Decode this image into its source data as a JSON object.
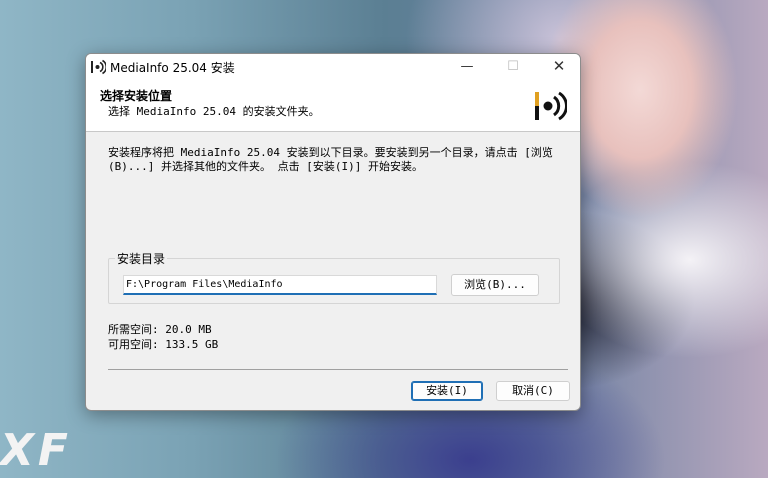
{
  "wallpaper": {
    "watermark": "XF"
  },
  "window": {
    "title": "MediaInfo 25.04 安装",
    "icon": "mediainfo-logo-icon",
    "controls": {
      "minimize": "—",
      "maximize": "☐",
      "close": "✕"
    }
  },
  "header": {
    "title": "选择安装位置",
    "subtitle": "选择 MediaInfo 25.04 的安装文件夹。"
  },
  "body": {
    "description": "安装程序将把 MediaInfo 25.04 安装到以下目录。要安装到另一个目录，请点击 [浏览(B)...] 并选择其他的文件夹。 点击 [安装(I)] 开始安装。",
    "group_label": "安装目录",
    "install_dir": "F:\\Program Files\\MediaInfo",
    "browse_label": "浏览(B)...",
    "space_required": "所需空间: 20.0 MB",
    "space_available": "可用空间: 133.5 GB"
  },
  "footer": {
    "install_label": "安装(I)",
    "cancel_label": "取消(C)"
  },
  "colors": {
    "accent": "#1f6fb5",
    "window_bg": "#f0f0f0"
  }
}
